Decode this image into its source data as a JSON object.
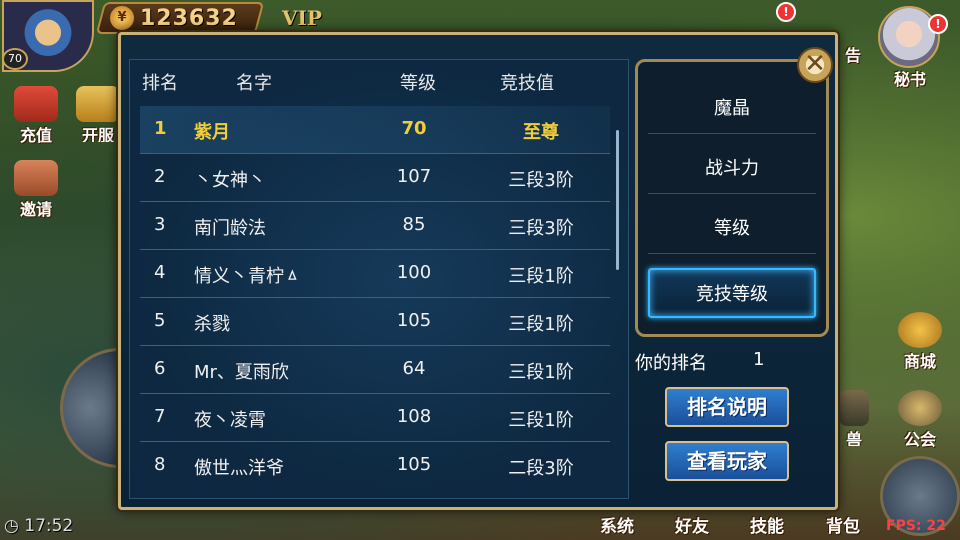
{
  "hud": {
    "player_level": "70",
    "gold_icon": "coin-icon",
    "gold_amount": "123632",
    "vip_label": "VIP",
    "recharge_label": "充值",
    "open_server_label": "开服",
    "invite_label": "邀请",
    "announce_label": "告",
    "secretary_label": "秘书",
    "shop_label": "商城",
    "guild_label": "公会",
    "beast_label": "兽",
    "notice_badge": "!",
    "clock": "17:52",
    "fps": "FPS: 22"
  },
  "bottom_menu": [
    "系统",
    "好友",
    "技能",
    "背包"
  ],
  "ranking": {
    "headers": {
      "rank": "排名",
      "name": "名字",
      "level": "等级",
      "arena": "竞技值"
    },
    "rows": [
      {
        "rank": "1",
        "name": "紫月",
        "level": "70",
        "arena": "至尊"
      },
      {
        "rank": "2",
        "name": "丶女神丶",
        "level": "107",
        "arena": "三段3阶"
      },
      {
        "rank": "3",
        "name": "南门龄法",
        "level": "85",
        "arena": "三段3阶"
      },
      {
        "rank": "4",
        "name": "情义丶青柠ㅿ",
        "level": "100",
        "arena": "三段1阶"
      },
      {
        "rank": "5",
        "name": "杀戮",
        "level": "105",
        "arena": "三段1阶"
      },
      {
        "rank": "6",
        "name": "Mr、夏雨欣",
        "level": "64",
        "arena": "三段1阶"
      },
      {
        "rank": "7",
        "name": "夜丶凌霄",
        "level": "108",
        "arena": "三段1阶"
      },
      {
        "rank": "8",
        "name": "傲世灬洋爷",
        "level": "105",
        "arena": "二段3阶"
      }
    ]
  },
  "categories": [
    {
      "label": "魔晶"
    },
    {
      "label": "战斗力"
    },
    {
      "label": "等级"
    },
    {
      "label": "竞技等级"
    }
  ],
  "my_rank": {
    "label": "你的排名",
    "value": "1"
  },
  "buttons": {
    "explain": "排名说明",
    "view_player": "查看玩家",
    "close_symbol": "✕"
  },
  "colors": {
    "highlight": "#f2cd3a",
    "active_tab_glow": "#3ab8ff",
    "panel_bg": "#0f2a3e",
    "frame_gold": "#c9b27a"
  }
}
